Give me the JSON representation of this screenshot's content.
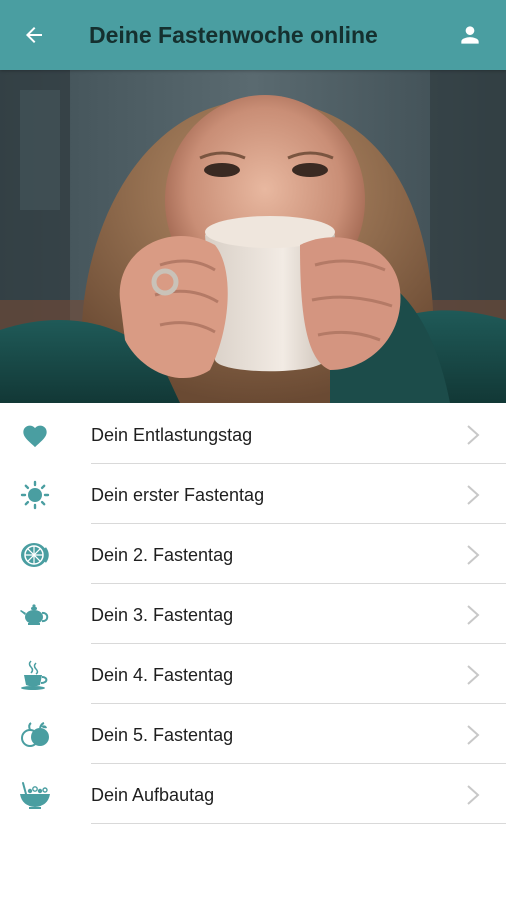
{
  "header": {
    "title": "Deine Fastenwoche online",
    "back_icon": "arrow-left-icon",
    "profile_icon": "person-icon"
  },
  "colors": {
    "accent": "#4a9ea1",
    "icon": "#4a9ea1",
    "title_text": "#15302f",
    "chevron": "#c8c8c8",
    "divider": "#d9d9d9"
  },
  "hero": {
    "description_icon": "hero-photo"
  },
  "days": [
    {
      "label": "Dein Entlastungstag",
      "icon": "heart-icon"
    },
    {
      "label": "Dein erster Fastentag",
      "icon": "sun-icon"
    },
    {
      "label": "Dein 2. Fastentag",
      "icon": "citrus-slice-icon"
    },
    {
      "label": "Dein 3. Fastentag",
      "icon": "teapot-icon"
    },
    {
      "label": "Dein 4. Fastentag",
      "icon": "tea-cup-icon"
    },
    {
      "label": "Dein 5. Fastentag",
      "icon": "apple-icon"
    },
    {
      "label": "Dein Aufbautag",
      "icon": "bowl-icon"
    }
  ]
}
